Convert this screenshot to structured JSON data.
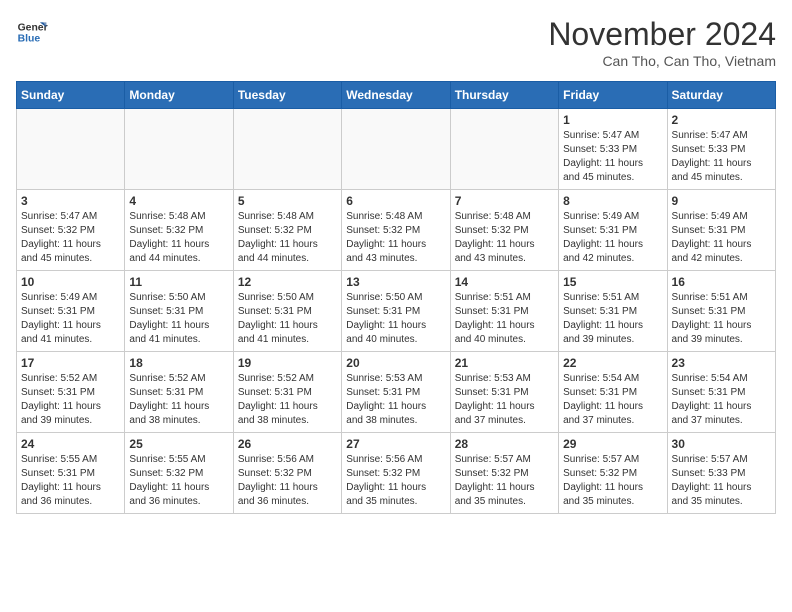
{
  "header": {
    "logo_line1": "General",
    "logo_line2": "Blue",
    "month_title": "November 2024",
    "location": "Can Tho, Can Tho, Vietnam"
  },
  "weekdays": [
    "Sunday",
    "Monday",
    "Tuesday",
    "Wednesday",
    "Thursday",
    "Friday",
    "Saturday"
  ],
  "weeks": [
    [
      {
        "day": "",
        "info": ""
      },
      {
        "day": "",
        "info": ""
      },
      {
        "day": "",
        "info": ""
      },
      {
        "day": "",
        "info": ""
      },
      {
        "day": "",
        "info": ""
      },
      {
        "day": "1",
        "info": "Sunrise: 5:47 AM\nSunset: 5:33 PM\nDaylight: 11 hours\nand 45 minutes."
      },
      {
        "day": "2",
        "info": "Sunrise: 5:47 AM\nSunset: 5:33 PM\nDaylight: 11 hours\nand 45 minutes."
      }
    ],
    [
      {
        "day": "3",
        "info": "Sunrise: 5:47 AM\nSunset: 5:32 PM\nDaylight: 11 hours\nand 45 minutes."
      },
      {
        "day": "4",
        "info": "Sunrise: 5:48 AM\nSunset: 5:32 PM\nDaylight: 11 hours\nand 44 minutes."
      },
      {
        "day": "5",
        "info": "Sunrise: 5:48 AM\nSunset: 5:32 PM\nDaylight: 11 hours\nand 44 minutes."
      },
      {
        "day": "6",
        "info": "Sunrise: 5:48 AM\nSunset: 5:32 PM\nDaylight: 11 hours\nand 43 minutes."
      },
      {
        "day": "7",
        "info": "Sunrise: 5:48 AM\nSunset: 5:32 PM\nDaylight: 11 hours\nand 43 minutes."
      },
      {
        "day": "8",
        "info": "Sunrise: 5:49 AM\nSunset: 5:31 PM\nDaylight: 11 hours\nand 42 minutes."
      },
      {
        "day": "9",
        "info": "Sunrise: 5:49 AM\nSunset: 5:31 PM\nDaylight: 11 hours\nand 42 minutes."
      }
    ],
    [
      {
        "day": "10",
        "info": "Sunrise: 5:49 AM\nSunset: 5:31 PM\nDaylight: 11 hours\nand 41 minutes."
      },
      {
        "day": "11",
        "info": "Sunrise: 5:50 AM\nSunset: 5:31 PM\nDaylight: 11 hours\nand 41 minutes."
      },
      {
        "day": "12",
        "info": "Sunrise: 5:50 AM\nSunset: 5:31 PM\nDaylight: 11 hours\nand 41 minutes."
      },
      {
        "day": "13",
        "info": "Sunrise: 5:50 AM\nSunset: 5:31 PM\nDaylight: 11 hours\nand 40 minutes."
      },
      {
        "day": "14",
        "info": "Sunrise: 5:51 AM\nSunset: 5:31 PM\nDaylight: 11 hours\nand 40 minutes."
      },
      {
        "day": "15",
        "info": "Sunrise: 5:51 AM\nSunset: 5:31 PM\nDaylight: 11 hours\nand 39 minutes."
      },
      {
        "day": "16",
        "info": "Sunrise: 5:51 AM\nSunset: 5:31 PM\nDaylight: 11 hours\nand 39 minutes."
      }
    ],
    [
      {
        "day": "17",
        "info": "Sunrise: 5:52 AM\nSunset: 5:31 PM\nDaylight: 11 hours\nand 39 minutes."
      },
      {
        "day": "18",
        "info": "Sunrise: 5:52 AM\nSunset: 5:31 PM\nDaylight: 11 hours\nand 38 minutes."
      },
      {
        "day": "19",
        "info": "Sunrise: 5:52 AM\nSunset: 5:31 PM\nDaylight: 11 hours\nand 38 minutes."
      },
      {
        "day": "20",
        "info": "Sunrise: 5:53 AM\nSunset: 5:31 PM\nDaylight: 11 hours\nand 38 minutes."
      },
      {
        "day": "21",
        "info": "Sunrise: 5:53 AM\nSunset: 5:31 PM\nDaylight: 11 hours\nand 37 minutes."
      },
      {
        "day": "22",
        "info": "Sunrise: 5:54 AM\nSunset: 5:31 PM\nDaylight: 11 hours\nand 37 minutes."
      },
      {
        "day": "23",
        "info": "Sunrise: 5:54 AM\nSunset: 5:31 PM\nDaylight: 11 hours\nand 37 minutes."
      }
    ],
    [
      {
        "day": "24",
        "info": "Sunrise: 5:55 AM\nSunset: 5:31 PM\nDaylight: 11 hours\nand 36 minutes."
      },
      {
        "day": "25",
        "info": "Sunrise: 5:55 AM\nSunset: 5:32 PM\nDaylight: 11 hours\nand 36 minutes."
      },
      {
        "day": "26",
        "info": "Sunrise: 5:56 AM\nSunset: 5:32 PM\nDaylight: 11 hours\nand 36 minutes."
      },
      {
        "day": "27",
        "info": "Sunrise: 5:56 AM\nSunset: 5:32 PM\nDaylight: 11 hours\nand 35 minutes."
      },
      {
        "day": "28",
        "info": "Sunrise: 5:57 AM\nSunset: 5:32 PM\nDaylight: 11 hours\nand 35 minutes."
      },
      {
        "day": "29",
        "info": "Sunrise: 5:57 AM\nSunset: 5:32 PM\nDaylight: 11 hours\nand 35 minutes."
      },
      {
        "day": "30",
        "info": "Sunrise: 5:57 AM\nSunset: 5:33 PM\nDaylight: 11 hours\nand 35 minutes."
      }
    ]
  ]
}
